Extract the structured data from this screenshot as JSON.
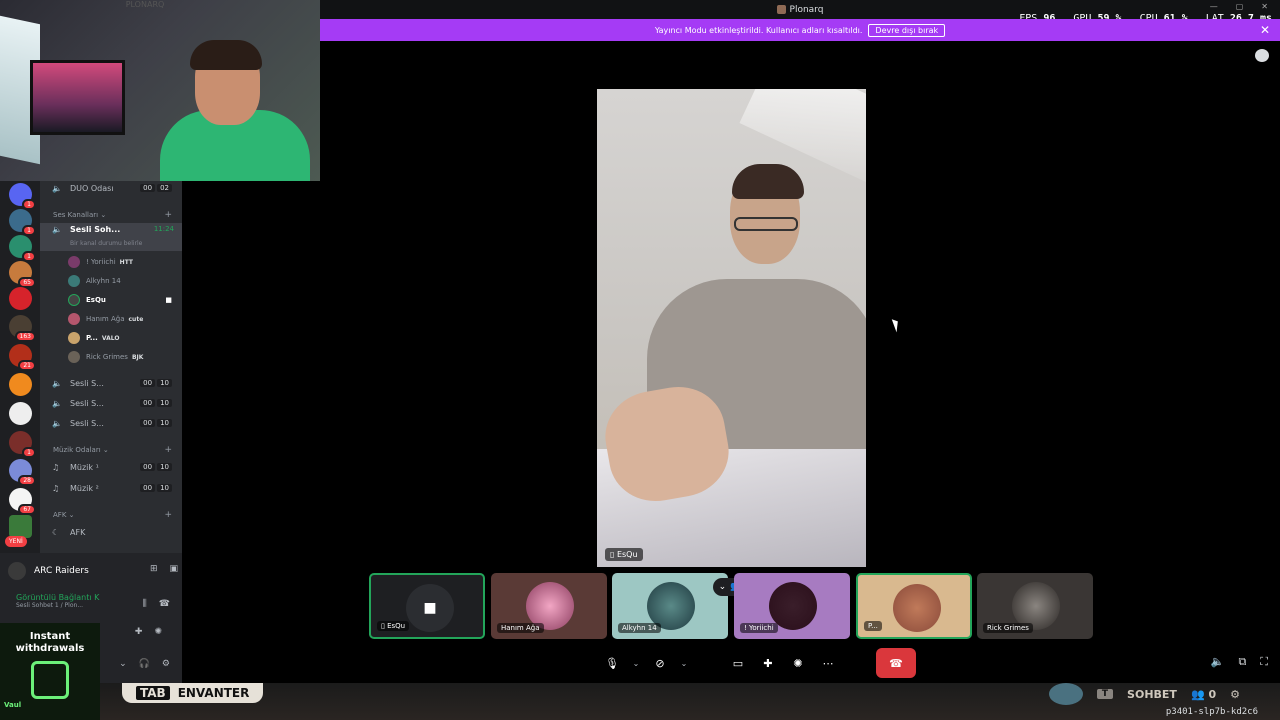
{
  "titlebar": {
    "app_name": "Plonarq"
  },
  "perf": [
    {
      "label": "FPS",
      "value": "96"
    },
    {
      "label": "GPU",
      "value": "59 %"
    },
    {
      "label": "CPU",
      "value": "61 %"
    },
    {
      "label": "LAT",
      "value": "26.7 ms"
    }
  ],
  "banner": {
    "message": "Yayıncı Modu etkinleştirildi. Kullanıcı adları kısaltıldı.",
    "button": "Devre dışı bırak",
    "close": "✕"
  },
  "webcam": {
    "logo_text": "PLONARQ"
  },
  "server_rail": {
    "badges": [
      "1",
      "1",
      "1",
      "65",
      "163",
      "21",
      "1",
      "28",
      "67"
    ],
    "new_label": "YENİ"
  },
  "channels": {
    "duo": {
      "name": "DUO Odası",
      "c1": "00",
      "c2": "02"
    },
    "voice_category": "Ses Kanalları",
    "active": {
      "name": "Sesli Soh...",
      "time": "11:24",
      "status": "Bir kanal durumu belirle"
    },
    "members": [
      {
        "name": "! Yoriichi",
        "tag": "HTT",
        "color": "#7a3b6a"
      },
      {
        "name": "Alkyhn 14",
        "tag": "",
        "color": "#3b7a78"
      },
      {
        "name": "EsQu",
        "tag": "",
        "color": "#444"
      },
      {
        "name": "Hanım Ağa",
        "tag": "cute",
        "color": "#b5566d"
      },
      {
        "name": "P...",
        "tag": "VALO",
        "color": "#c9a36b"
      },
      {
        "name": "Rick Grimes",
        "tag": "BJK",
        "color": "#6a6258"
      }
    ],
    "voice_rooms": [
      {
        "name": "Sesli S...",
        "c1": "00",
        "c2": "10"
      },
      {
        "name": "Sesli S...",
        "c1": "00",
        "c2": "10"
      },
      {
        "name": "Sesli S...",
        "c1": "00",
        "c2": "10"
      }
    ],
    "music_category": "Müzik Odaları",
    "music_rooms": [
      {
        "name": "Müzik ¹",
        "c1": "00",
        "c2": "10"
      },
      {
        "name": "Müzik ²",
        "c1": "00",
        "c2": "10"
      }
    ],
    "afk_category": "AFK",
    "afk_room": "AFK"
  },
  "voice_panel": {
    "game": "ARC Raiders",
    "connected": "Görüntülü Bağlantı K",
    "connected_sub": "Sesli Sohbet 1 / Plon..."
  },
  "promo": {
    "line1": "Instant",
    "line2": "withdrawals",
    "brand": "Vaul"
  },
  "main_video": {
    "label": "EsQu"
  },
  "tiles": [
    {
      "label": "EsQu",
      "bg": "#1e1f22"
    },
    {
      "label": "Hanım Ağa",
      "bg": "#5a3a36"
    },
    {
      "label": "Alkyhn 14",
      "bg": "#9dc7c3"
    },
    {
      "label": "! Yoriichi",
      "bg": "#a77bc1"
    },
    {
      "label": "P...",
      "bg": "#d9b98f"
    },
    {
      "label": "Rick Grimes",
      "bg": "#3a3634"
    }
  ],
  "hud": {
    "tab_key": "TAB",
    "tab_label": "ENVANTER",
    "key2": "T",
    "chat": "SOHBET",
    "party_count": "0"
  },
  "session_id": "p3401-slp7b-kd2c6",
  "colors": {
    "accent": "#a53bf5",
    "speaking": "#23a55a",
    "hangup": "#da373c"
  }
}
